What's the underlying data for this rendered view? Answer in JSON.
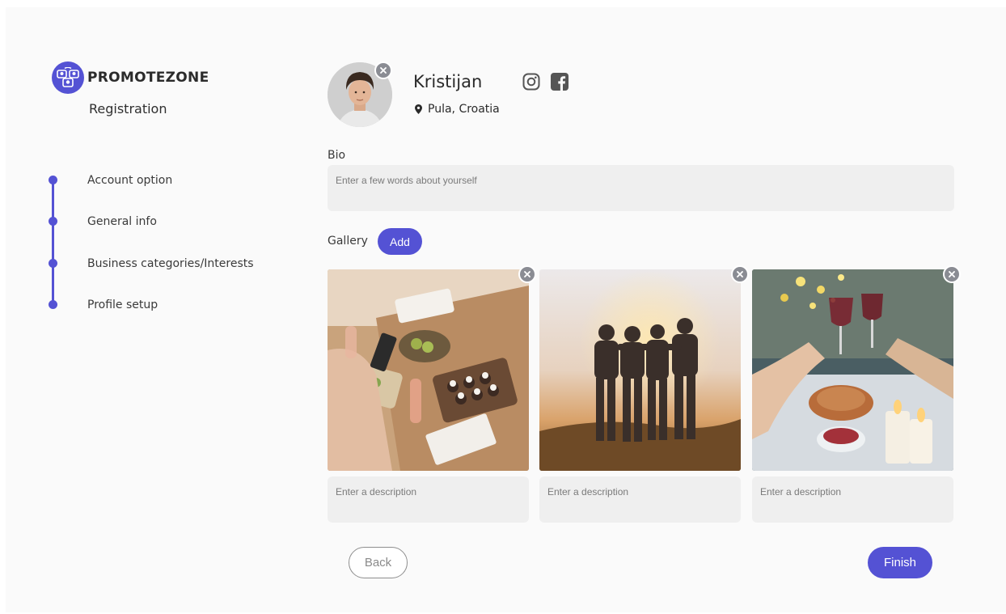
{
  "brand": {
    "name": "PROMOTEZONE",
    "subtitle": "Registration",
    "accent_color": "#5452d4"
  },
  "steps": [
    {
      "label": "Account option"
    },
    {
      "label": "General info"
    },
    {
      "label": "Business categories/Interests"
    },
    {
      "label": "Profile setup"
    }
  ],
  "profile": {
    "name": "Kristijan",
    "location": "Pula, Croatia",
    "social_icons": [
      "instagram-icon",
      "facebook-icon"
    ]
  },
  "bio": {
    "label": "Bio",
    "placeholder": "Enter a few words about yourself",
    "value": ""
  },
  "gallery": {
    "label": "Gallery",
    "add_label": "Add",
    "items": [
      {
        "photo": "food-table-photo",
        "description_placeholder": "Enter a description"
      },
      {
        "photo": "friends-sunset-photo",
        "description_placeholder": "Enter a description"
      },
      {
        "photo": "wine-toast-photo",
        "description_placeholder": "Enter a description"
      }
    ]
  },
  "actions": {
    "back_label": "Back",
    "finish_label": "Finish"
  }
}
